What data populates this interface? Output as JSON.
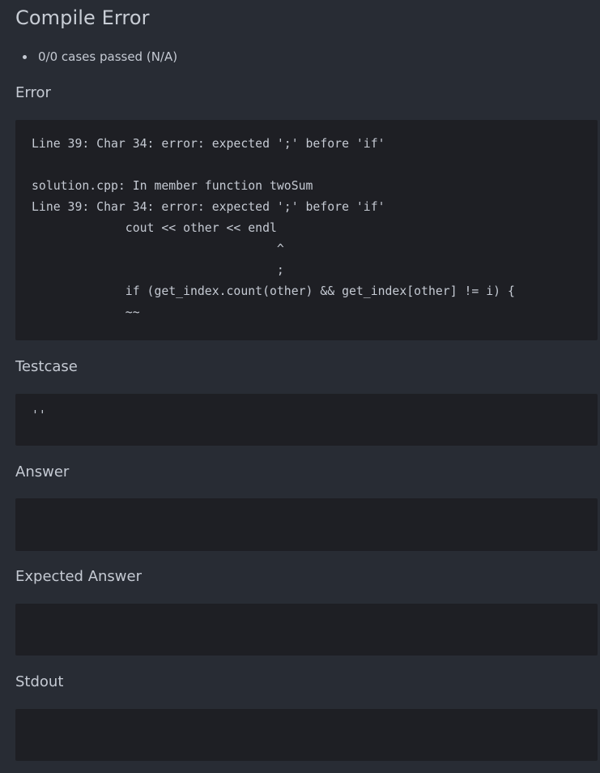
{
  "result": {
    "title": "Compile Error",
    "cases_summary": "0/0 cases passed (N/A)"
  },
  "sections": {
    "error": {
      "label": "Error",
      "content": "Line 39: Char 34: error: expected ';' before 'if'\n\nsolution.cpp: In member function twoSum\nLine 39: Char 34: error: expected ';' before 'if'\n             cout << other << endl\n                                  ^\n                                  ;\n             if (get_index.count(other) && get_index[other] != i) {\n             ~~"
    },
    "testcase": {
      "label": "Testcase",
      "content": "''"
    },
    "answer": {
      "label": "Answer",
      "content": ""
    },
    "expected_answer": {
      "label": "Expected Answer",
      "content": ""
    },
    "stdout": {
      "label": "Stdout",
      "content": ""
    }
  }
}
